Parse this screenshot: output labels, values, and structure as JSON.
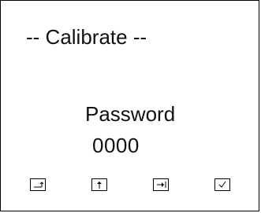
{
  "screen": {
    "title": "-- Calibrate --",
    "password_label": "Password",
    "password_value": "0000"
  },
  "softkeys": [
    {
      "icon": "enter-return-icon"
    },
    {
      "icon": "arrow-up-icon"
    },
    {
      "icon": "arrow-right-icon"
    },
    {
      "icon": "checkmark-icon"
    }
  ],
  "colors": {
    "background": "#ffffff",
    "text": "#111111",
    "border": "#000000"
  }
}
